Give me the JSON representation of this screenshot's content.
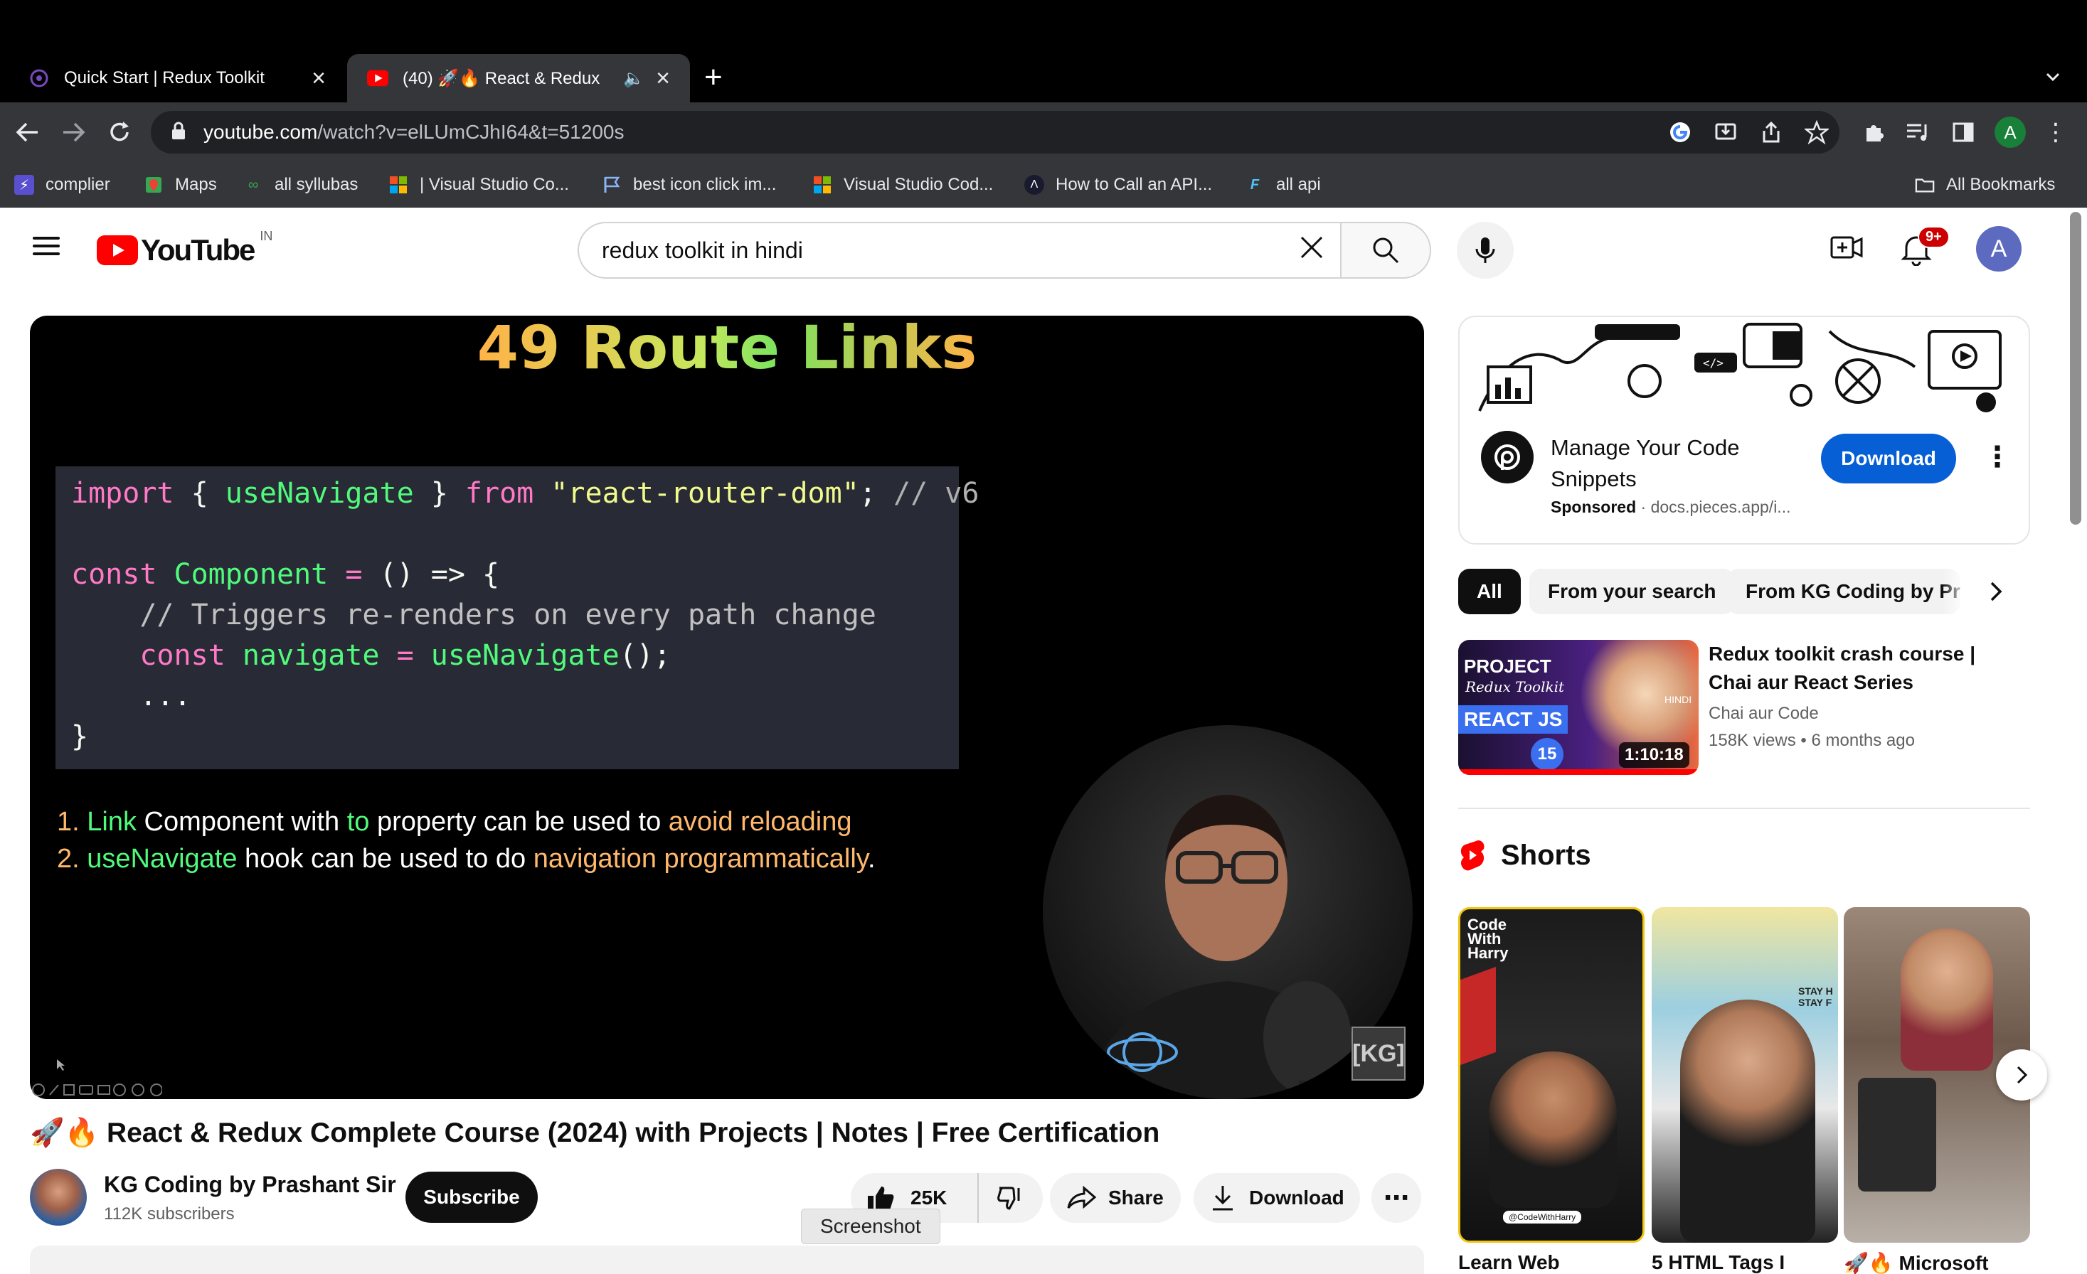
{
  "browser": {
    "tabs": [
      {
        "title": "Quick Start | Redux Toolkit"
      },
      {
        "title": "(40) 🚀🔥 React & Redux"
      }
    ],
    "new_tab_symbol": "+",
    "address": {
      "domain": "youtube.com",
      "path": "/watch?v=elLUmCJhI64&t=51200s"
    },
    "bookmarks": [
      "complier",
      "Maps",
      "all syllubas",
      "| Visual Studio Co...",
      "best icon click im...",
      "Visual Studio Cod...",
      "How to Call an API...",
      "all api"
    ],
    "all_bookmarks": "All Bookmarks",
    "profile_initial": "A",
    "accent": "#188038"
  },
  "youtube": {
    "logo_text": "YouTube",
    "region": "IN",
    "search_value": "redux toolkit in hindi",
    "notifications_badge": "9+",
    "avatar_initial": "A",
    "brand_color": "#ff0000"
  },
  "video": {
    "slide_title": "49 Route Links",
    "code_lines": [
      [
        [
          "import",
          "#ff79c6"
        ],
        [
          " { ",
          "#f8f8f2"
        ],
        [
          "useNavigate",
          "#50fa7b"
        ],
        [
          " } ",
          "#f8f8f2"
        ],
        [
          "from",
          "#ff79c6"
        ],
        [
          " ",
          "#f8f8f2"
        ],
        [
          "\"react-router-dom\"",
          "#f1fa8c"
        ],
        [
          "; ",
          "#f8f8f2"
        ],
        [
          "// v6",
          "#b0b0b0"
        ]
      ],
      [],
      [
        [
          "const",
          "#ff79c6"
        ],
        [
          " ",
          "#f8f8f2"
        ],
        [
          "Component",
          "#50fa7b"
        ],
        [
          " ",
          "#f8f8f2"
        ],
        [
          "=",
          "#ff79c6"
        ],
        [
          " () => {",
          "#f8f8f2"
        ]
      ],
      [
        [
          "    // Triggers re-renders on every path change",
          "#c0c0c0"
        ]
      ],
      [
        [
          "    ",
          "#f8f8f2"
        ],
        [
          "const",
          "#ff79c6"
        ],
        [
          " ",
          "#f8f8f2"
        ],
        [
          "navigate",
          "#50fa7b"
        ],
        [
          " ",
          "#f8f8f2"
        ],
        [
          "=",
          "#ff79c6"
        ],
        [
          " ",
          "#f8f8f2"
        ],
        [
          "useNavigate",
          "#50fa7b"
        ],
        [
          "();",
          "#f8f8f2"
        ]
      ],
      [
        [
          "    ...",
          "#f8f8f2"
        ]
      ],
      [
        [
          "}",
          "#f8f8f2"
        ]
      ]
    ],
    "notes": [
      {
        "num": "1.",
        "parts": [
          [
            "Link",
            "#50fa7b"
          ],
          [
            " Component with ",
            "#ffffff"
          ],
          [
            "to",
            "#50fa7b"
          ],
          [
            " property can be used to ",
            "#ffffff"
          ],
          [
            "avoid reloading",
            "#ffb86c"
          ]
        ]
      },
      {
        "num": "2.",
        "parts": [
          [
            "useNavigate",
            "#50fa7b"
          ],
          [
            " hook can be used to do ",
            "#ffffff"
          ],
          [
            "navigation programmatically",
            "#ffb86c"
          ],
          [
            ".",
            "#ffffff"
          ]
        ]
      }
    ],
    "watermark": "[KG]",
    "title": "🚀🔥 React & Redux Complete Course (2024) with Projects | Notes | Free Certification",
    "channel": {
      "name": "KG Coding by Prashant Sir",
      "subscribers": "112K subscribers"
    },
    "subscribe_label": "Subscribe",
    "likes": "25K",
    "share_label": "Share",
    "download_label": "Download",
    "more_label": "⋯",
    "tooltip": "Screenshot"
  },
  "sidebar": {
    "ad": {
      "title": "Manage Your Code Snippets",
      "sponsored": "Sponsored",
      "domain": "docs.pieces.app/i...",
      "cta": "Download"
    },
    "chips": [
      "All",
      "From your search",
      "From KG Coding by Pra"
    ],
    "recommended": {
      "title": "Redux toolkit crash course | Chai aur React Series",
      "channel": "Chai aur Code",
      "views": "158K views",
      "age": "6 months ago",
      "duration": "1:10:18",
      "thumb_project": "PROJECT",
      "thumb_sub": "Redux Toolkit",
      "thumb_react": "REACT JS",
      "thumb_num": "15",
      "thumb_hindi": "HINDI"
    },
    "shorts_heading": "Shorts",
    "shorts": [
      {
        "caption": "Learn Web",
        "tag": "@CodeWithHarry",
        "logo": "Code With Harry"
      },
      {
        "caption": "5 HTML Tags I",
        "sign": "STAY H STAY F"
      },
      {
        "caption": "🚀🔥 Microsoft"
      }
    ]
  }
}
